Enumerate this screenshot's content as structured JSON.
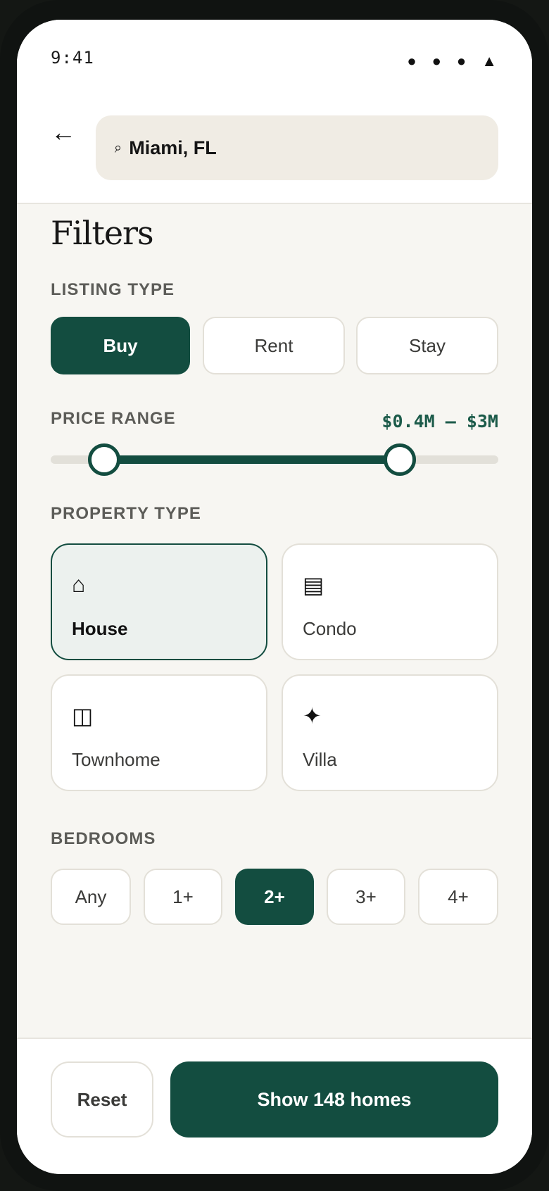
{
  "status": {
    "time": "9:41",
    "icons": [
      "signal-dot-icon",
      "wifi-dot-icon",
      "battery-dot-icon",
      "triangle-icon"
    ]
  },
  "header": {
    "back_icon": "←",
    "search_icon": "⌕",
    "search_value": "Miami, FL"
  },
  "page": {
    "title": "Filters"
  },
  "listing_type": {
    "label": "LISTING TYPE",
    "options": [
      {
        "label": "Buy",
        "selected": true
      },
      {
        "label": "Rent",
        "selected": false
      },
      {
        "label": "Stay",
        "selected": false
      }
    ]
  },
  "price_range": {
    "label": "PRICE RANGE",
    "display": "$0.4M – $3M",
    "min_fraction": 0.12,
    "max_fraction": 0.78
  },
  "property_type": {
    "label": "PROPERTY TYPE",
    "options": [
      {
        "label": "House",
        "icon": "⌂",
        "icon_name": "house-icon",
        "selected": true
      },
      {
        "label": "Condo",
        "icon": "▤",
        "icon_name": "condo-icon",
        "selected": false
      },
      {
        "label": "Townhome",
        "icon": "◫",
        "icon_name": "townhome-icon",
        "selected": false
      },
      {
        "label": "Villa",
        "icon": "✦",
        "icon_name": "villa-icon",
        "selected": false
      }
    ]
  },
  "bedrooms": {
    "label": "BEDROOMS",
    "options": [
      {
        "label": "Any"
      },
      {
        "label": "1+"
      },
      {
        "label": "2+",
        "selected": true
      },
      {
        "label": "3+"
      },
      {
        "label": "4+"
      }
    ]
  },
  "footer": {
    "reset_label": "Reset",
    "show_label": "Show 148 homes"
  },
  "colors": {
    "accent": "#134d40",
    "surface": "#f7f6f2",
    "search_bg": "#f0ece4"
  }
}
